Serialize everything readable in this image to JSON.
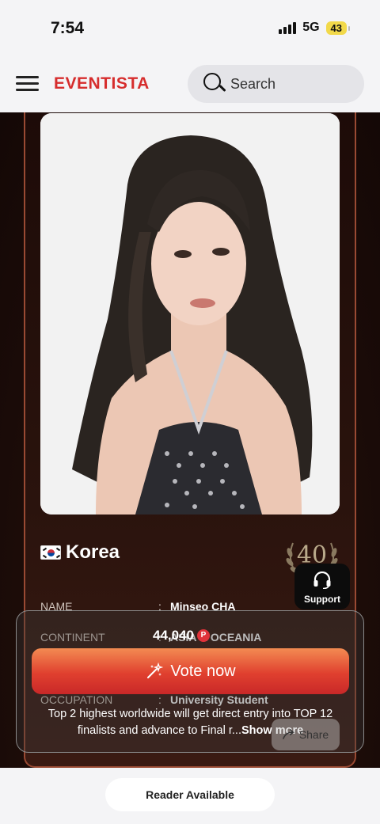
{
  "status_bar": {
    "time": "7:54",
    "network": "5G",
    "battery": "43"
  },
  "header": {
    "brand": "EVENTISTA",
    "brand_color": "#d62d2d",
    "search_placeholder": "Search",
    "search_icon": "search-icon",
    "menu_icon": "hamburger-icon"
  },
  "contestant": {
    "country": "Korea",
    "flag_icon": "south-korea-flag-icon",
    "rank": "40",
    "fields": [
      {
        "label": "NAME",
        "value": "Minseo CHA"
      },
      {
        "label": "CONTINENT",
        "value": "ASIA & OCEANIA"
      },
      {
        "label": "OCCUPATION",
        "value": "University Student"
      }
    ]
  },
  "support": {
    "label": "Support",
    "icon": "headset-icon"
  },
  "vote": {
    "count": "44,040",
    "points_icon": "P",
    "button_label": "Vote now",
    "button_icon": "magic-wand-icon",
    "description": "Top 2 highest worldwide will get direct entry into TOP 12 finalists and advance to Final r...",
    "show_more": "Show more",
    "share_label": "Share",
    "accent_color": "#e0402f"
  },
  "reader": {
    "label": "Reader Available"
  }
}
